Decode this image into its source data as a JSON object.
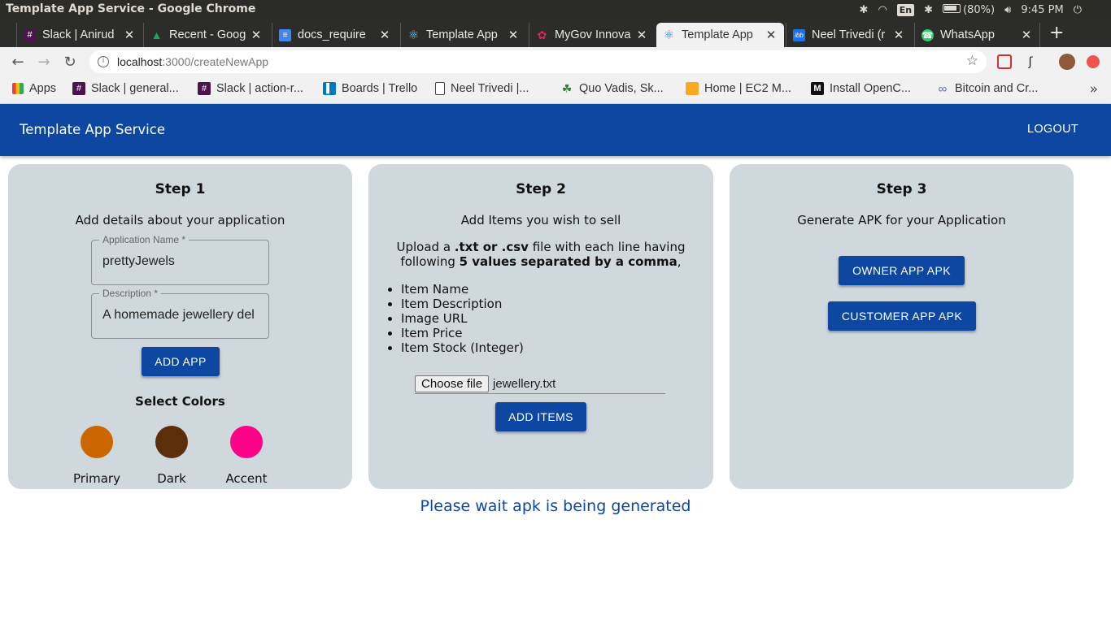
{
  "window": {
    "title": "Template App Service - Google Chrome"
  },
  "tray": {
    "language": "En",
    "battery": "(80%)",
    "time": "9:45 PM"
  },
  "tabs": [
    {
      "title": "Slack | Anirud",
      "icon": "slack-icon",
      "color": "#4a154b"
    },
    {
      "title": "Recent - Goog",
      "icon": "google-drive-icon",
      "color": "#1fa463"
    },
    {
      "title": "docs_require",
      "icon": "google-docs-icon",
      "color": "#4285f4"
    },
    {
      "title": "Template App",
      "icon": "react-icon",
      "color": "#61dafb"
    },
    {
      "title": "MyGov Innova",
      "icon": "mygov-icon",
      "color": "#e91e63"
    },
    {
      "title": "Template App",
      "icon": "react-icon",
      "color": "#61dafb",
      "active": true
    },
    {
      "title": "Neel Trivedi (r",
      "icon": "ibb-icon",
      "color": "#1a73e8"
    },
    {
      "title": "WhatsApp",
      "icon": "whatsapp-icon",
      "color": "#25d366"
    }
  ],
  "omnibox": {
    "host": "localhost",
    "path": ":3000/createNewApp"
  },
  "bookmarks": [
    {
      "label": "Apps",
      "icon": "apps-grid-icon"
    },
    {
      "label": "Slack | general...",
      "icon": "slack-icon"
    },
    {
      "label": "Slack | action-r...",
      "icon": "slack-icon"
    },
    {
      "label": "Boards | Trello",
      "icon": "trello-icon"
    },
    {
      "label": "Neel Trivedi |...",
      "icon": "page-icon"
    },
    {
      "label": "Quo Vadis, Sk...",
      "icon": "leaf-icon"
    },
    {
      "label": "Home | EC2 M...",
      "icon": "aws-icon"
    },
    {
      "label": "Install OpenC...",
      "icon": "medium-icon"
    },
    {
      "label": "Bitcoin and Cr...",
      "icon": "link-icon"
    }
  ],
  "header": {
    "title": "Template App Service",
    "logout": "LOGOUT"
  },
  "step1": {
    "title": "Step 1",
    "subtitle": "Add details about your application",
    "app_name_label": "Application Name *",
    "app_name_value": "prettyJewels",
    "description_label": "Description *",
    "description_value": "A homemade jewellery del",
    "add_app_button": "ADD APP",
    "colors_title": "Select Colors",
    "colors": [
      {
        "label": "Primary",
        "hex": "#cc6600"
      },
      {
        "label": "Dark",
        "hex": "#5c2e0a"
      },
      {
        "label": "Accent",
        "hex": "#ff0088"
      }
    ]
  },
  "step2": {
    "title": "Step 2",
    "subtitle": "Add Items you wish to sell",
    "upload_pre": "Upload a ",
    "upload_bold1": ".txt or .csv",
    "upload_mid": " file with each line having following ",
    "upload_bold2": "5 values separated by a comma",
    "upload_post": ",",
    "fields": [
      "Item Name",
      "Item Description",
      "Image URL",
      "Item Price",
      "Item Stock (Integer)"
    ],
    "choose_file": "Choose file",
    "file_name": "jewellery.txt",
    "add_items_button": "ADD ITEMS"
  },
  "step3": {
    "title": "Step 3",
    "subtitle": "Generate APK for your Application",
    "owner_button": "OWNER APP APK",
    "customer_button": "CUSTOMER APP APK"
  },
  "status": "Please wait apk is being generated"
}
